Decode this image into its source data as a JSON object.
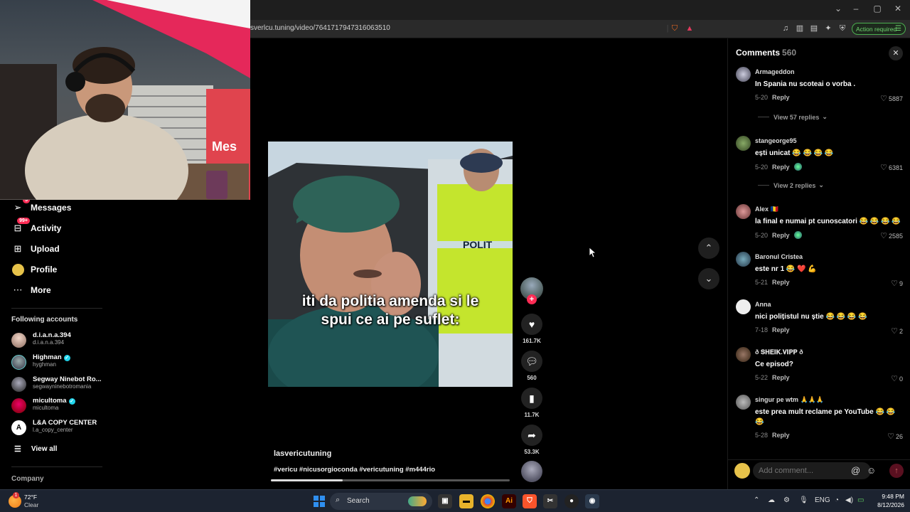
{
  "browser": {
    "url": "sverlcu.tuning/video/7641717947316063510",
    "action_label": "Action required"
  },
  "nav": {
    "items": [
      {
        "label": "Messages",
        "icon": "send-icon",
        "badge": "3"
      },
      {
        "label": "Activity",
        "icon": "inbox-icon",
        "badge": "99+"
      },
      {
        "label": "Upload",
        "icon": "plus-square-icon",
        "badge": ""
      },
      {
        "label": "Profile",
        "icon": "avatar-icon",
        "badge": ""
      },
      {
        "label": "More",
        "icon": "more-dots-icon",
        "badge": ""
      }
    ],
    "following_heading": "Following accounts",
    "accounts": [
      {
        "name": "d.i.a.n.a.394",
        "handle": "d.i.a.n.a.394",
        "verified": false
      },
      {
        "name": "Highman",
        "handle": "hyghman",
        "verified": true
      },
      {
        "name": "Segway Ninebot Ro...",
        "handle": "segwayninebotromania",
        "verified": false
      },
      {
        "name": "micultoma",
        "handle": "micultoma",
        "verified": true
      },
      {
        "name": "L&A COPY CENTER",
        "handle": "l.a_copy_center",
        "verified": false
      }
    ],
    "view_all": "View all",
    "company": "Company"
  },
  "video": {
    "caption": "iti da politia amenda si le spui ce ai pe suflet:",
    "author": "lasvericutuning",
    "tags": "#vericu #nicusorgioconda #vericutuning #m444rio",
    "progress": 0.3
  },
  "actions": {
    "likes": "161.7K",
    "comments": "560",
    "saves": "11.7K",
    "shares": "53.3K"
  },
  "comments_panel": {
    "title": "Comments",
    "count": "560",
    "input_placeholder": "Add comment...",
    "items": [
      {
        "user": "Armageddon",
        "text": "In Spania nu scoteai o vorba .",
        "date": "5-20",
        "reply": "Reply",
        "likes": "5887",
        "view_replies": "View 57 replies"
      },
      {
        "user": "stangeorge95",
        "text": "ești unicat 😂 😂 😂 😂",
        "date": "5-20",
        "reply": "Reply",
        "likes": "6381",
        "view_replies": "View 2 replies"
      },
      {
        "user": "Alex 🇷🇴",
        "text": "la final e numai pt cunoscatori 😂 😂 😂 😂",
        "date": "5-20",
        "reply": "Reply",
        "likes": "2585",
        "view_replies": ""
      },
      {
        "user": "Baronul Cristea",
        "text": "este nr 1 😂 ❤️ 💪",
        "date": "5-21",
        "reply": "Reply",
        "likes": "9",
        "view_replies": ""
      },
      {
        "user": "Anna",
        "text": "nici polițistul nu știe 😂 😂 😂 😂",
        "date": "7-18",
        "reply": "Reply",
        "likes": "2",
        "view_replies": ""
      },
      {
        "user": "ð 𝐒𝐇𝐄𝐈𝐊.𝐕𝐈𝐏𝐏 ð",
        "text": "Ce episod?",
        "date": "5-22",
        "reply": "Reply",
        "likes": "0",
        "view_replies": ""
      },
      {
        "user": "singur pe wtm 🙏🙏🙏",
        "text": "este prea mult reclame pe YouTube 😂 😂 😂",
        "date": "5-28",
        "reply": "Reply",
        "likes": "26",
        "view_replies": ""
      }
    ]
  },
  "taskbar": {
    "weather_temp": "72°F",
    "weather_desc": "Clear",
    "search_label": "Search",
    "language": "ENG",
    "time": "9:48 PM",
    "date": "8/12/2026"
  },
  "colors": {
    "accent": "#fe2c55",
    "verified": "#20d5ec",
    "action_green": "#4caf50"
  }
}
